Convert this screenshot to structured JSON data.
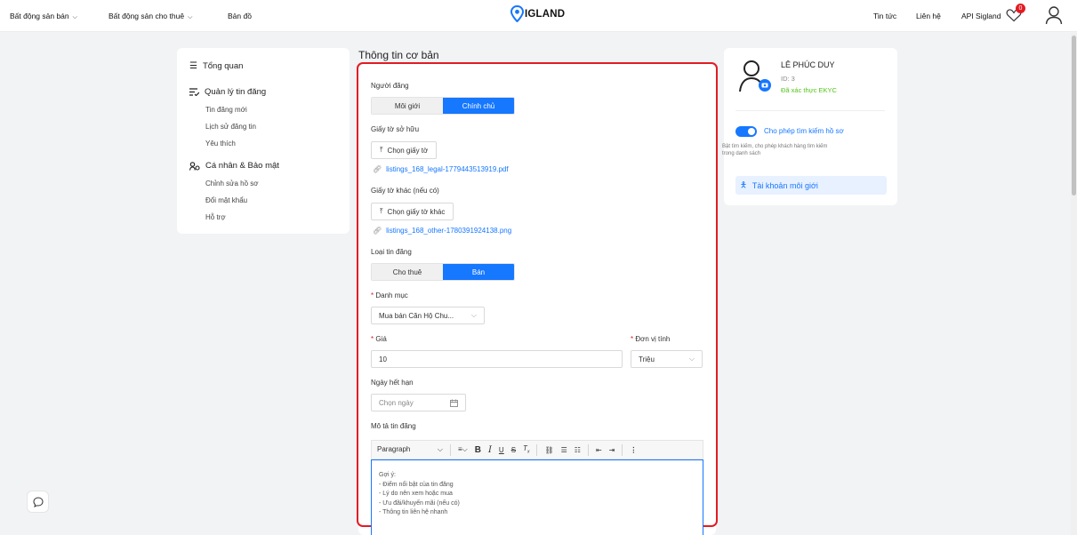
{
  "header": {
    "nav": [
      {
        "label": "Bất động sản bán",
        "has_caret": true
      },
      {
        "label": "Bất động sản cho thuê",
        "has_caret": true
      },
      {
        "label": "Bản đồ",
        "has_caret": false
      }
    ],
    "logo_text": "IGLAND",
    "right_links": [
      "Tin tức",
      "Liên hệ",
      "API Sigland"
    ],
    "favorites_badge": "0",
    "brand_color": "#1677ff"
  },
  "sidebar": {
    "overview": "Tổng quan",
    "listing_mgmt": {
      "title": "Quản lý tin đăng",
      "items": [
        "Tin đăng mới",
        "Lịch sử đăng tin",
        "Yêu thích"
      ]
    },
    "personal": {
      "title": "Cá nhân & Bảo mật",
      "items": [
        "Chỉnh sửa hồ sơ",
        "Đổi mật khẩu",
        "Hỗ trợ"
      ]
    }
  },
  "form": {
    "section_title": "Thông tin cơ bản",
    "poster": {
      "label": "Người đăng",
      "options": [
        "Môi giới",
        "Chính chủ"
      ],
      "selected": "Chính chủ"
    },
    "ownership_doc": {
      "label": "Giấy tờ sở hữu",
      "button": "Chọn giấy tờ",
      "file": "listings_168_legal-1779443513919.pdf"
    },
    "other_doc": {
      "label": "Giấy tờ khác (nếu có)",
      "button": "Chọn giấy tờ khác",
      "file": "listings_168_other-1780391924138.png"
    },
    "listing_type": {
      "label": "Loại tin đăng",
      "options": [
        "Cho thuê",
        "Bán"
      ],
      "selected": "Bán"
    },
    "category": {
      "label": "Danh mục",
      "value": "Mua bán Căn Hộ Chu..."
    },
    "price": {
      "label": "Giá",
      "value": "10"
    },
    "unit": {
      "label": "Đơn vị tính",
      "value": "Triệu"
    },
    "expiry": {
      "label": "Ngày hết hạn",
      "placeholder": "Chọn ngày"
    },
    "description": {
      "label": "Mô tả tin đăng",
      "block_format": "Paragraph",
      "hint_lines": [
        "Gợi ý:",
        "- Điểm nổi bật của tin đăng",
        "- Lý do nên xem hoặc mua",
        "- Ưu đãi/khuyến mãi (nếu có)",
        "- Thông tin liên hệ nhanh"
      ]
    }
  },
  "profile": {
    "name": "LÊ PHÚC DUY",
    "id": "ID: 3",
    "verified": "Đã xác thực EKYC",
    "verified_color": "#52c41a",
    "search_toggle_label": "Cho phép tìm kiếm hồ sơ",
    "search_toggle_on": true,
    "search_toggle_desc": [
      "Bật tìm kiếm, cho phép khách hàng tìm kiếm",
      "trong danh sách"
    ],
    "broker_account": "Tài khoản môi giới"
  },
  "accent_red": "#e31b23"
}
